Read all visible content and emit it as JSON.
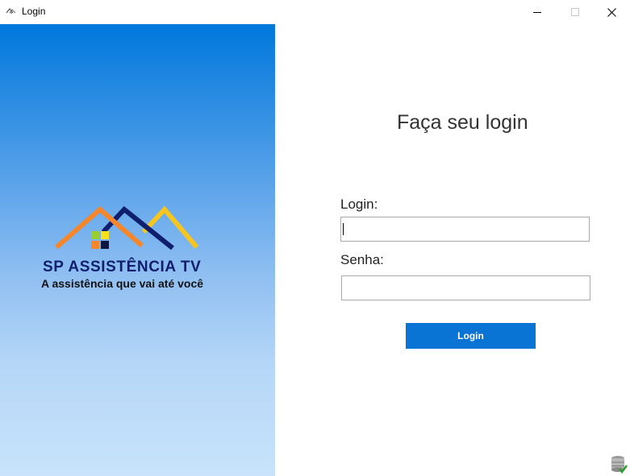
{
  "window": {
    "title": "Login",
    "controls": [
      "minimize",
      "maximize",
      "close"
    ]
  },
  "branding": {
    "name": "SP ASSISTÊNCIA TV",
    "tagline": "A assistência que vai até você",
    "colors": {
      "gradient_top": "#0077dd",
      "gradient_bottom": "#c8e3fb",
      "roof_orange": "#f5862a",
      "roof_navy": "#0f1f6e",
      "roof_yellow": "#f7c520",
      "window_green": "#9acd32"
    }
  },
  "form": {
    "title": "Faça seu login",
    "login_label": "Login:",
    "login_value": "",
    "password_label": "Senha:",
    "password_value": "",
    "submit_label": "Login",
    "accent_color": "#0a74d4"
  },
  "status": {
    "icon": "database-check-icon"
  }
}
